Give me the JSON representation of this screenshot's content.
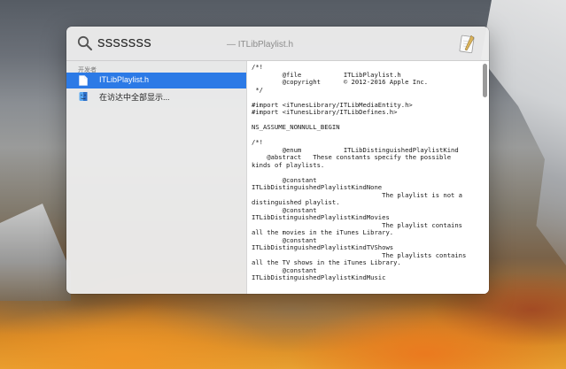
{
  "search": {
    "query": "sssssss",
    "hint": "— ITLibPlaylist.h"
  },
  "results": {
    "section_header": "开发者",
    "items": [
      {
        "label": "ITLibPlaylist.h",
        "icon": "header-file-icon",
        "selected": true
      },
      {
        "label": "在访达中全部显示...",
        "icon": "finder-icon",
        "selected": false
      }
    ]
  },
  "preview": {
    "lines": [
      "/*!",
      "        @file           ITLibPlaylist.h",
      "        @copyright      © 2012-2016 Apple Inc.",
      " */",
      "",
      "#import <iTunesLibrary/ITLibMediaEntity.h>",
      "#import <iTunesLibrary/ITLibDefines.h>",
      "",
      "NS_ASSUME_NONNULL_BEGIN",
      "",
      "/*!",
      "        @enum           ITLibDistinguishedPlaylistKind",
      "    @abstract   These constants specify the possible",
      "kinds of playlists.",
      "",
      "        @constant",
      "ITLibDistinguishedPlaylistKindNone",
      "                                  The playlist is not a",
      "distinguished playlist.",
      "        @constant",
      "ITLibDistinguishedPlaylistKindMovies",
      "                                  The playlist contains",
      "all the movies in the iTunes Library.",
      "        @constant",
      "ITLibDistinguishedPlaylistKindTVShows",
      "                                  The playlists contains",
      "all the TV shows in the iTunes Library.",
      "        @constant",
      "ITLibDistinguishedPlaylistKindMusic"
    ]
  },
  "colors": {
    "selection": "#2c7ae6",
    "window_bg": "#ececec"
  }
}
